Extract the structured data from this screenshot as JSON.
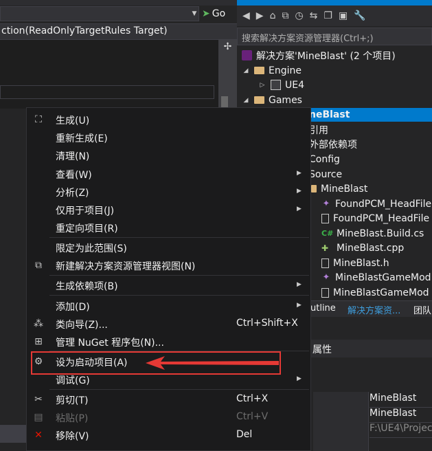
{
  "editor": {
    "go_label": "Go",
    "signature_text": "ction(ReadOnlyTargetRules Target)"
  },
  "solution_explorer": {
    "search_placeholder": "搜索解决方案资源管理器(Ctrl+;)",
    "items": [
      {
        "label": "解决方案'MineBlast' (2 个项目)",
        "icon": "vs-solution-icon"
      },
      {
        "label": "Engine",
        "icon": "folder-icon"
      },
      {
        "label": "UE4",
        "icon": "ue4-project-icon"
      },
      {
        "label": "Games",
        "icon": "folder-icon"
      },
      {
        "label": "neBlast",
        "icon": "none"
      },
      {
        "label": "引用",
        "icon": "none"
      },
      {
        "label": "外部依赖项",
        "icon": "none"
      },
      {
        "label": "Config",
        "icon": "none"
      },
      {
        "label": "Source",
        "icon": "none"
      },
      {
        "label": "MineBlast",
        "icon": "folder-icon"
      },
      {
        "label": "FoundPCM_HeadFile",
        "icon": "pin-icon"
      },
      {
        "label": "FoundPCM_HeadFile",
        "icon": "file-icon"
      },
      {
        "label": "MineBlast.Build.cs",
        "icon": "csharp-icon"
      },
      {
        "label": "MineBlast.cpp",
        "icon": "cpp-icon"
      },
      {
        "label": "MineBlast.h",
        "icon": "file-icon"
      },
      {
        "label": "MineBlastGameMod",
        "icon": "pin-icon"
      },
      {
        "label": "MineBlastGameMod",
        "icon": "file-icon"
      }
    ],
    "tabs": [
      "utline",
      "解决方案资...",
      "团队"
    ],
    "properties_label": "属性",
    "property_values": [
      "MineBlast",
      "MineBlast",
      "F:\\UE4\\Projec"
    ]
  },
  "context_menu": {
    "items": [
      {
        "label": "生成(U)",
        "icon": "build-icon",
        "shortcut": "",
        "submenu": false,
        "disabled": false
      },
      {
        "label": "重新生成(E)",
        "icon": "",
        "shortcut": "",
        "submenu": false,
        "disabled": false
      },
      {
        "label": "清理(N)",
        "icon": "",
        "shortcut": "",
        "submenu": false,
        "disabled": false
      },
      {
        "label": "查看(W)",
        "icon": "",
        "shortcut": "",
        "submenu": true,
        "disabled": false
      },
      {
        "label": "分析(Z)",
        "icon": "",
        "shortcut": "",
        "submenu": true,
        "disabled": false
      },
      {
        "label": "仅用于项目(J)",
        "icon": "",
        "shortcut": "",
        "submenu": true,
        "disabled": false
      },
      {
        "label": "重定向项目(R)",
        "icon": "",
        "shortcut": "",
        "submenu": false,
        "disabled": false
      },
      {
        "label": "限定为此范围(S)",
        "icon": "",
        "shortcut": "",
        "submenu": false,
        "disabled": false
      },
      {
        "label": "新建解决方案资源管理器视图(N)",
        "icon": "new-view-icon",
        "shortcut": "",
        "submenu": false,
        "disabled": false
      },
      {
        "label": "生成依赖项(B)",
        "icon": "",
        "shortcut": "",
        "submenu": true,
        "disabled": false
      },
      {
        "label": "添加(D)",
        "icon": "",
        "shortcut": "",
        "submenu": true,
        "disabled": false
      },
      {
        "label": "类向导(Z)...",
        "icon": "class-wizard-icon",
        "shortcut": "Ctrl+Shift+X",
        "submenu": false,
        "disabled": false
      },
      {
        "label": "管理 NuGet 程序包(N)...",
        "icon": "nuget-icon",
        "shortcut": "",
        "submenu": false,
        "disabled": false
      },
      {
        "label": "设为启动项目(A)",
        "icon": "gear-icon",
        "shortcut": "",
        "submenu": false,
        "disabled": false
      },
      {
        "label": "调试(G)",
        "icon": "",
        "shortcut": "",
        "submenu": true,
        "disabled": false
      },
      {
        "label": "剪切(T)",
        "icon": "scissors-icon",
        "shortcut": "Ctrl+X",
        "submenu": false,
        "disabled": false
      },
      {
        "label": "粘贴(P)",
        "icon": "paste-icon",
        "shortcut": "Ctrl+V",
        "submenu": false,
        "disabled": true
      },
      {
        "label": "移除(V)",
        "icon": "remove-x-icon",
        "shortcut": "Del",
        "submenu": false,
        "disabled": false
      }
    ]
  },
  "colors": {
    "accent": "#007acc",
    "highlight": "#e53935"
  }
}
